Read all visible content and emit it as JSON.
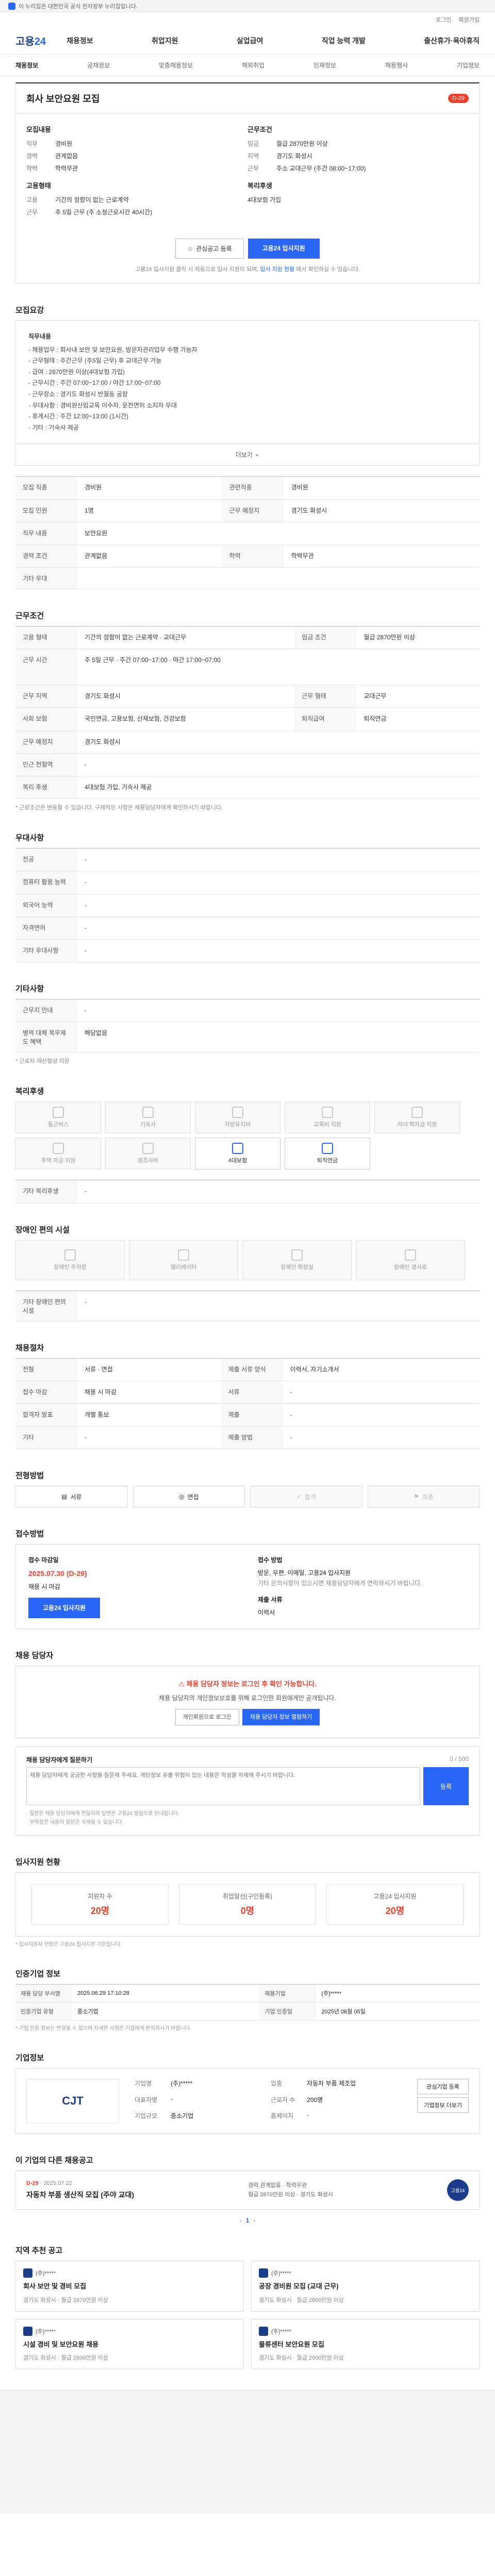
{
  "topbar": {
    "notice": "이 누리집은 대한민국 공식 전자정부 누리집입니다."
  },
  "util": [
    "로그인",
    "회원가입"
  ],
  "gnb": {
    "logo_a": "고용",
    "logo_b": "24",
    "menu": [
      "채용정보",
      "취업지원",
      "실업급여",
      "직업 능력 개발",
      "출산휴가·육아휴직"
    ]
  },
  "subnav": [
    "채용정보",
    "공채정보",
    "맞춤채용정보",
    "해외취업",
    "인재정보",
    "채용행사",
    "기업정보"
  ],
  "job": {
    "title": "회사 보안요원 모집",
    "dday": "D-29",
    "recruit_title": "모집내용",
    "recruit": [
      {
        "k": "직무",
        "v": "경비원"
      },
      {
        "k": "경력",
        "v": "관계없음"
      },
      {
        "k": "학력",
        "v": "학력무관"
      }
    ],
    "cond_title": "근무조건",
    "cond": [
      {
        "k": "임금",
        "v": "월급 2870만원 이상"
      },
      {
        "k": "지역",
        "v": "경기도 화성시"
      },
      {
        "k": "근무",
        "v": "주소 교대근무 (주간 08:00~17:00)"
      }
    ],
    "type_title": "고용형태",
    "type": [
      {
        "k": "고용",
        "v": "기간의 정함이 없는 근로계약"
      },
      {
        "k": "근무",
        "v": "주 5일 근무 (주 소정근로시간 40시간)"
      }
    ],
    "welfare_title": "복리후생",
    "welfare": [
      {
        "k": "",
        "v": "4대보험 가입"
      }
    ],
    "btn_scrap": "관심공고 등록",
    "btn_apply": "고용24 입사지원",
    "note_a": "고용24 입사지원 클릭 시 자동으로 입사 지원이 되며,",
    "note_b": "입사 지원 현황",
    "note_c": "에서 확인하실 수 있습니다."
  },
  "duty": {
    "title": "모집요강",
    "head_1": "직무내용",
    "lines": [
      "- 채용업무 : 회사내 보안 및 보안요원, 방문자관리업무 수행 가능자",
      "- 근무형태 : 주간근무 (주5일 근무) 후 교대근무 가능",
      "- 급여 : 2870만원 이상(4대보험 가입)",
      "- 근무시간 : 주간 07:00~17:00 / 야간 17:00~07:00",
      "- 근무장소 : 경기도 화성시 반월동 공장",
      "- 우대사항 : 경비원신임교육 이수자, 운전면허 소지자 우대",
      "- 휴게시간 : 주간 12:00~13:00 (1시간)",
      "- 기타 : 기숙사 제공"
    ],
    "more": "더보기"
  },
  "recruit_table": {
    "rows": [
      [
        "모집 직종",
        "경비원",
        "관련직종",
        "경비원"
      ],
      [
        "모집 인원",
        "1명",
        "근무 예정지",
        "경기도 화성시"
      ],
      [
        "직무 내용",
        "보안요원",
        "",
        ""
      ],
      [
        "경력 조건",
        "관계없음",
        "학력",
        "학력무관"
      ],
      [
        "기타 우대",
        "",
        "",
        ""
      ]
    ]
  },
  "cond_table": {
    "title": "근무조건",
    "rows": [
      [
        "고용 형태",
        "기간의 정함이 없는 근로계약 · 교대근무",
        "임금 조건",
        "월급 2870만원 이상"
      ],
      [
        "근무 시간",
        "주 5일 근무 · 주간 07:00~17:00 · 야간 17:00~07:00",
        "",
        ""
      ],
      [
        "근무 지역",
        "경기도 화성시",
        "근무 형태",
        "교대근무"
      ],
      [
        "사회 보험",
        "국민연금, 고용보험, 산재보험, 건강보험",
        "퇴직급여",
        "퇴직연금"
      ],
      [
        "근무 예정지",
        "경기도 화성시",
        "",
        ""
      ],
      [
        "인근 전철역",
        "-",
        "",
        ""
      ],
      [
        "복리 후생",
        "4대보험 가입, 기숙사 제공",
        "",
        ""
      ]
    ],
    "note": "* 근로조건은 변동될 수 있습니다. 구체적인 사항은 채용담당자에게 확인하시기 바랍니다."
  },
  "pref_table": {
    "title": "우대사항",
    "rows": [
      [
        "전공",
        "-"
      ],
      [
        "컴퓨터 활용 능력",
        "-"
      ],
      [
        "외국어 능력",
        "-"
      ],
      [
        "자격면허",
        "-"
      ],
      [
        "기타 우대사항",
        "-"
      ]
    ]
  },
  "etc_table": {
    "title": "기타사항",
    "rows": [
      [
        "근무지 안내",
        "-"
      ],
      [
        "병역 대체 복무제도 혜택",
        "해당없음"
      ]
    ],
    "note": "* 근로자 재산형성 지원"
  },
  "welfare_section": {
    "title": "복리후생",
    "items": [
      "통근버스",
      "기숙사",
      "차량유지비",
      "교육비 지원",
      "자녀 학자금 지원",
      "주택 자금 지원",
      "경조사비",
      "4대보험",
      "퇴직연금"
    ],
    "row_label": "기타 복리후생",
    "row_value": "-"
  },
  "disability": {
    "title": "장애인 편의 시설",
    "items": [
      "장애인 주차장",
      "엘리베이터",
      "장애인 화장실",
      "장애인 경사로"
    ],
    "row_label": "기타 장애인 편의 시설",
    "row_value": "-"
  },
  "apply_method": {
    "title": "채용절차",
    "rows": [
      [
        "전형",
        "서류 · 면접",
        "제출 서류 양식",
        "이력서, 자기소개서"
      ],
      [
        "접수 마감",
        "채용 시 마감",
        "서류",
        "-"
      ],
      [
        "합격자 발표",
        "개별 통보",
        "제출",
        "-"
      ],
      [
        "기타",
        "-",
        "제출 방법",
        "-"
      ]
    ]
  },
  "process": {
    "title": "전형방법",
    "steps": [
      "서류",
      "면접",
      "합격",
      "최종"
    ]
  },
  "reception": {
    "title": "접수방법",
    "date_label": "접수 마감일",
    "date": "2025.07.30 (D-29)",
    "date_sub": "채용 시 마감",
    "btn": "고용24 입사지원",
    "method_label": "접수 방법",
    "method": "방문, 우편, 이메일, 고용24 입사지원",
    "method_sub": "기타 문의사항이 있으시면 채용담당자에게 연락하시기 바랍니다.",
    "docs_label": "제출 서류",
    "docs": "이력서"
  },
  "contact_warn": {
    "title": "채용 담당자",
    "wt": "채용 담당자 정보는 로그인 후 확인 가능합니다.",
    "desc": "채용 담당자의 개인정보보호를 위해 로그인한 회원에게만 공개됩니다.",
    "btn_a": "개인회원으로 로그인",
    "btn_b": "채용 담당자 정보 열람하기"
  },
  "qa": {
    "title": "채용 담당자에게 질문하기",
    "counter": "0 / 500",
    "placeholder": "채용 담당자에게 궁금한 사항을 질문해 주세요. 개인정보 유출 위험이 있는 내용은 작성을 자제해 주시기 바랍니다.",
    "btn": "등록",
    "notes": [
      "· 질문은 채용 담당자에게 전달되며 답변은 고용24 알림으로 안내됩니다.",
      "· 부적절한 내용의 질문은 삭제될 수 있습니다."
    ]
  },
  "stats": {
    "title": "입사지원 현황",
    "items": [
      {
        "label": "지원자 수",
        "n": "20명"
      },
      {
        "label": "취업알선(구인등록)",
        "n": "0명"
      },
      {
        "label": "고용24 입사지원",
        "n": "20명"
      }
    ],
    "note": "* 입사지원자 현황은 고용24 입사지원 기준입니다."
  },
  "contact_info": {
    "title": "인증기업 정보",
    "rows": [
      [
        "채용 담당 부서명",
        "2025.06.29 17:10:28",
        "채용기업",
        "(주)*****"
      ],
      [
        "인증기업 유형",
        "중소기업",
        "기업 인증일",
        "2025년 06월 05일"
      ]
    ],
    "note": "* 기업 인증 정보는 변경될 수 있으며 자세한 사항은 기업에게 문의하시기 바랍니다."
  },
  "company": {
    "title": "기업정보",
    "logo": "CJT",
    "rows": [
      [
        "기업명",
        "(주)*****"
      ],
      [
        "업종",
        "자동차 부품 제조업"
      ],
      [
        "대표자명",
        "-"
      ],
      [
        "근로자 수",
        "200명"
      ],
      [
        "기업규모",
        "중소기업"
      ],
      [
        "홈페이지",
        "-"
      ]
    ],
    "btns": [
      "관심기업 등록",
      "기업정보 더보기"
    ]
  },
  "others": {
    "title": "이 기업의 다른 채용공고",
    "item": {
      "dday": "D-29",
      "date": "2025.07.22",
      "title": "자동차 부품 생산직 모집 (주야 교대)",
      "m1": "경력 관계없음 · 학력무관",
      "m2": "월급 2870만원 이상 · 경기도 화성시",
      "badge": "고용24"
    },
    "pager": [
      "1"
    ]
  },
  "recommend": {
    "title": "지역 추천 공고",
    "cards": [
      {
        "co": "(주)*****",
        "t": "회사 보안 및 경비 모집",
        "m": "경기도 화성시 · 월급 2870만원 이상"
      },
      {
        "co": "(주)*****",
        "t": "공장 경비원 모집 (교대 근무)",
        "m": "경기도 화성시 · 월급 2800만원 이상"
      },
      {
        "co": "(주)*****",
        "t": "시설 경비 및 보안요원 채용",
        "m": "경기도 화성시 · 월급 2600만원 이상"
      },
      {
        "co": "(주)*****",
        "t": "물류센터 보안요원 모집",
        "m": "경기도 화성시 · 월급 2900만원 이상"
      }
    ]
  }
}
